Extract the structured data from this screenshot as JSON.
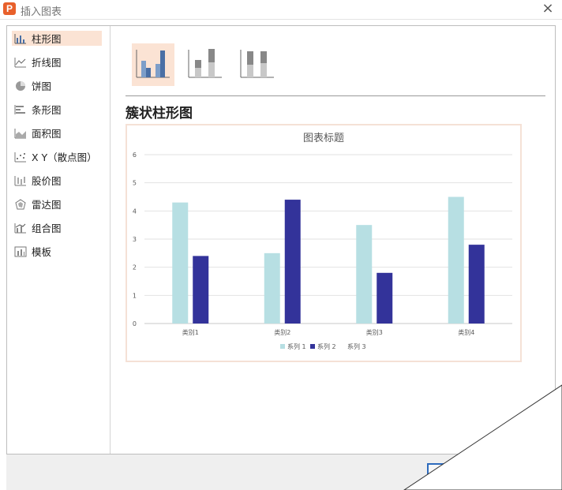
{
  "window": {
    "app_icon_letter": "P",
    "title": "插入图表",
    "close_glyph": "×",
    "accent": "#e8602b"
  },
  "sidebar": {
    "items": [
      {
        "label": "柱形图",
        "icon": "column-chart-icon",
        "active": true
      },
      {
        "label": "折线图",
        "icon": "line-chart-icon"
      },
      {
        "label": "饼图",
        "icon": "pie-chart-icon"
      },
      {
        "label": "条形图",
        "icon": "bar-chart-icon"
      },
      {
        "label": "面积图",
        "icon": "area-chart-icon"
      },
      {
        "label": "X Y（散点图）",
        "icon": "scatter-chart-icon"
      },
      {
        "label": "股价图",
        "icon": "stock-chart-icon"
      },
      {
        "label": "雷达图",
        "icon": "radar-chart-icon"
      },
      {
        "label": "组合图",
        "icon": "combo-chart-icon"
      },
      {
        "label": "模板",
        "icon": "template-icon"
      }
    ]
  },
  "subtypes": [
    "clustered-column-icon",
    "stacked-column-icon",
    "percent-stacked-column-icon"
  ],
  "selected_subtype": 0,
  "chart_type_name": "簇状柱形图",
  "chart_data": {
    "type": "bar",
    "title": "图表标题",
    "categories": [
      "类别1",
      "类别2",
      "类别3",
      "类别4"
    ],
    "series": [
      {
        "name": "系列 1",
        "values": [
          4.3,
          2.5,
          3.5,
          4.5
        ],
        "color": "#b7dfe3"
      },
      {
        "name": "系列 2",
        "values": [
          2.4,
          4.4,
          1.8,
          2.8
        ],
        "color": "#33339a"
      },
      {
        "name": "系列 3",
        "values": [],
        "color": "#a0a0a0"
      }
    ],
    "ylim": [
      0,
      6
    ],
    "yticks": [
      0,
      1,
      2,
      3,
      4,
      5,
      6
    ],
    "xlabel": "",
    "ylabel": "",
    "grid": true,
    "legend": "bottom"
  }
}
